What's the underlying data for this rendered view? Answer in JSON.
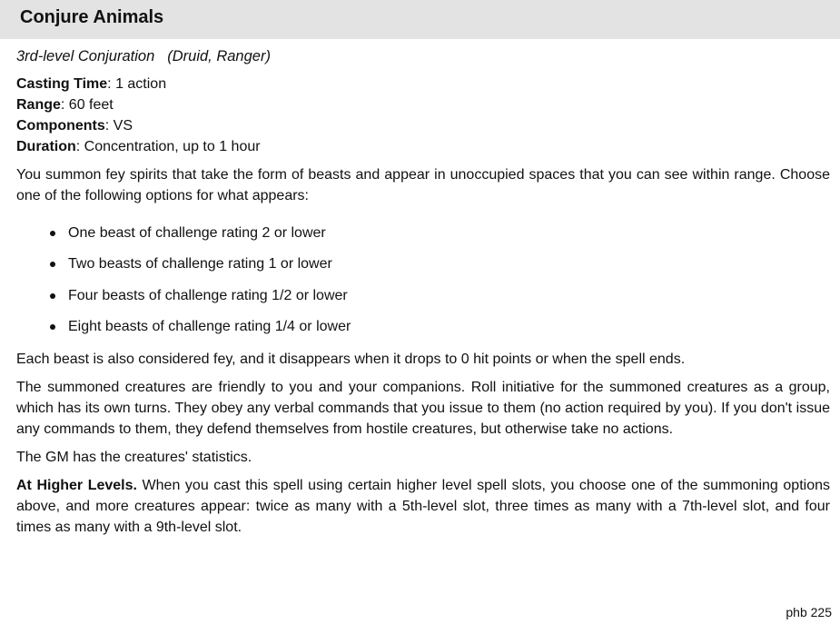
{
  "spell": {
    "name": "Conjure Animals",
    "school_line": "3rd-level Conjuration",
    "classes": "(Druid, Ranger)",
    "casting_time_label": "Casting Time",
    "casting_time": "1 action",
    "range_label": "Range",
    "range": "60 feet",
    "components_label": "Components",
    "components": "VS",
    "duration_label": "Duration",
    "duration": "Concentration, up to 1 hour",
    "intro": "You summon fey spirits that take the form of beasts and appear in unoccupied spaces that you can see within range. Choose one of the following options for what appears:",
    "options": [
      "One beast of challenge rating 2 or lower",
      "Two beasts of challenge rating 1 or lower",
      "Four beasts of challenge rating 1/2 or lower",
      "Eight beasts of challenge rating 1/4 or lower"
    ],
    "paragraph_fey": "Each beast is also considered fey, and it disappears when it drops to 0 hit points or when the spell ends.",
    "paragraph_friendly": "The summoned creatures are friendly to you and your companions. Roll initiative for the summoned creatures as a group, which has its own turns. They obey any verbal commands that you issue to them (no action required by you). If you don't issue any commands to them, they defend themselves from hostile creatures, but otherwise take no actions.",
    "paragraph_gm": "The GM has the creatures' statistics.",
    "higher_levels_label": "At Higher Levels.",
    "higher_levels_text": "When you cast this spell using certain higher level spell slots, you choose one of the summoning options above, and more creatures appear: twice as many with a 5th-level slot, three times as many with a 7th-level slot, and four times as many with a 9th-level slot."
  },
  "footer": {
    "source": "phb 225"
  }
}
